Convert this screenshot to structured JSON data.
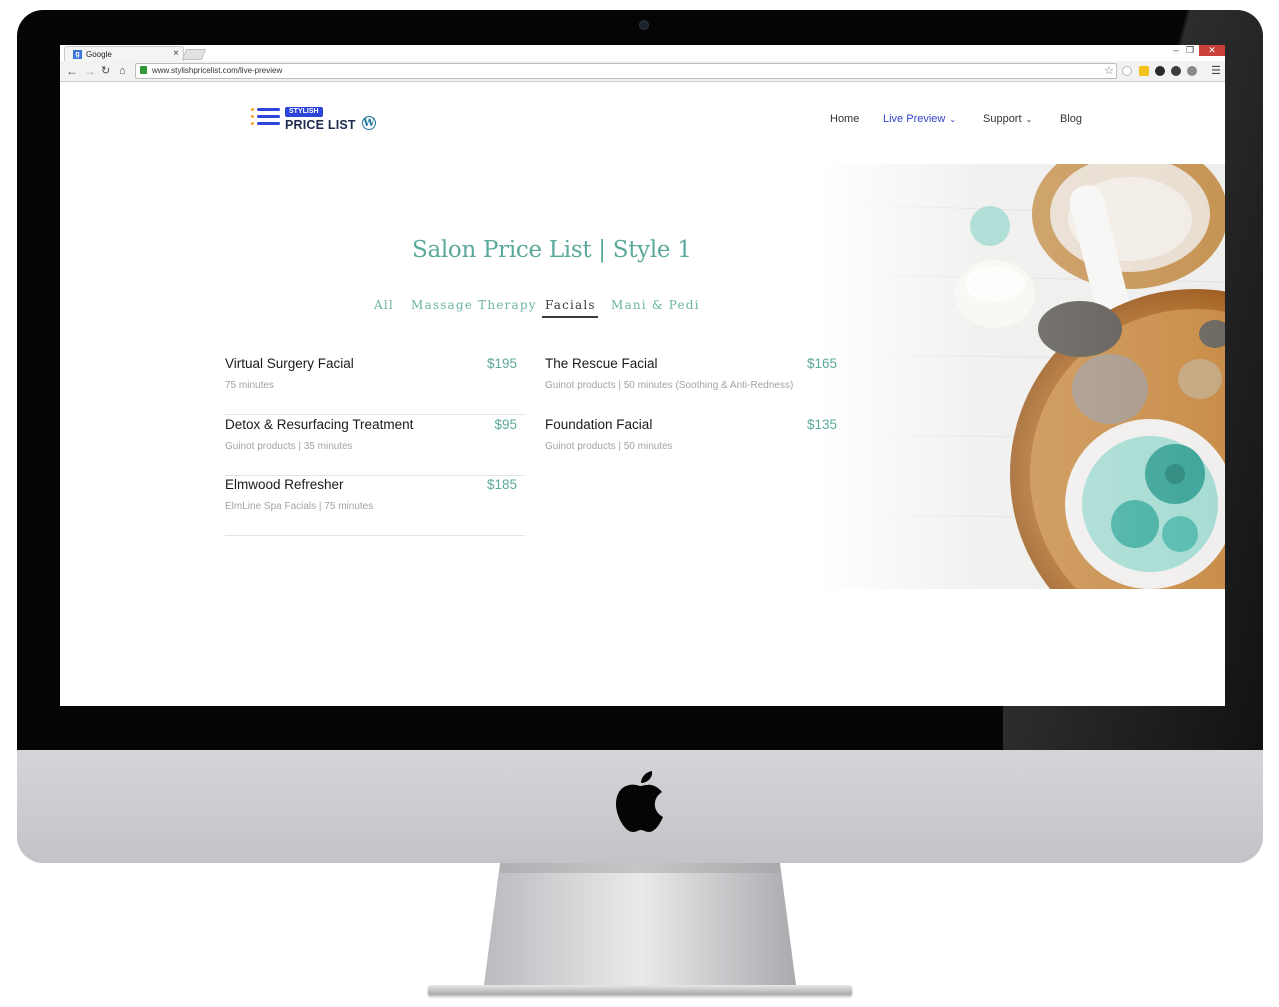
{
  "browser": {
    "tab_title": "Google",
    "tab_close": "×",
    "url": "www.stylishpricelist.com/live-preview",
    "window_min": "–",
    "window_max": "❐",
    "window_close": "✕"
  },
  "site": {
    "logo_badge": "STYLISH",
    "logo_name": "PRICE LIST",
    "nav": [
      {
        "label": "Home"
      },
      {
        "label": "Live Preview",
        "active": true,
        "has_dropdown": true
      },
      {
        "label": "Support",
        "has_dropdown": true
      },
      {
        "label": "Blog"
      }
    ]
  },
  "price_list": {
    "title": "Salon Price List | Style 1",
    "categories": [
      "All",
      "Massage Therapy",
      "Facials",
      "Mani & Pedi"
    ],
    "active_category": "Facials",
    "items": [
      {
        "name": "Virtual Surgery Facial",
        "price": "$195",
        "desc": "75 minutes"
      },
      {
        "name": "Detox & Resurfacing Treatment",
        "price": "$95",
        "desc": "Guinot products | 35 minutes"
      },
      {
        "name": "Elmwood Refresher",
        "price": "$185",
        "desc": "ElmLine Spa Facials | 75 minutes"
      },
      {
        "name": "The Rescue Facial",
        "price": "$165",
        "desc": "Guinot products | 50 minutes (Soothing & Anti-Redness)"
      },
      {
        "name": "Foundation Facial",
        "price": "$135",
        "desc": "Guinot products | 50 minutes"
      }
    ]
  },
  "colors": {
    "accent_teal": "#5aa99a",
    "nav_active": "#3344cc",
    "logo_blue": "#2c44d8",
    "logo_orange": "#f5a623"
  }
}
